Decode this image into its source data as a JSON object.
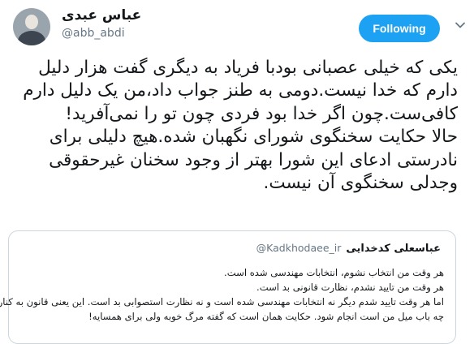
{
  "author": {
    "name": "عباس عبدی",
    "handle": "@abb_abdi"
  },
  "follow_button": {
    "label": "Following"
  },
  "tweet": {
    "lines": [
      "یکی که خیلی عصبانی بودبا فریاد به دیگری گفت هزار دلیل",
      "دارم که خدا نیست.دومی به طنز جواب داد،من یک دلیل دارم",
      "کافی‌ست.چون اگر خدا بود فردی چون تو را نمی‌آفرید!",
      "حالا حکایت سخنگوی شورای نگهبان شده.هیچ دلیلی برای",
      "نادرستی ادعای این شورا بهتر از وجود سخنان غیرحقوقی",
      "وجدلی سخنگوی آن نیست."
    ]
  },
  "quoted_tweet": {
    "name": "عباسعلی کدخدایی",
    "handle": "@Kadkhodaee_ir",
    "lines": [
      "هر وقت من انتخاب نشوم، انتخابات مهندسی شده است.",
      "هر وقت من تایید نشدم، نظارت قانونی بد است.",
      "اما هر وقت تایید شدم دیگر نه انتخابات مهندسی شده است و نه نظارت استصوابی بد است. این یعنی قانون به کنار، هر",
      "چه باب میل من است انجام شود. حکایت همان است که گفته مرگ خوبه ولی برای همسایه!"
    ]
  },
  "colors": {
    "accent": "#1da1f2",
    "secondary_text": "#657786",
    "border": "#ccd6dd"
  },
  "icons": {
    "avatar": "avatar",
    "menu": "chevron-down-icon"
  }
}
